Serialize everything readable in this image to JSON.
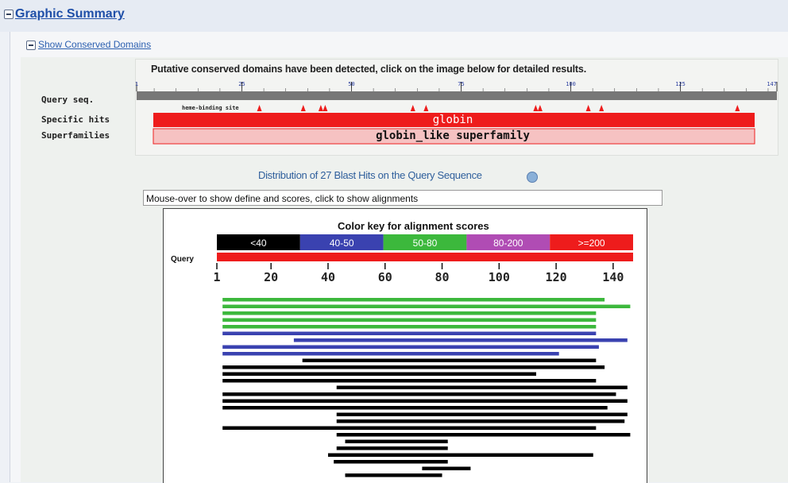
{
  "header": {
    "title": "Graphic Summary"
  },
  "conserved": {
    "toggle_label": "Show Conserved Domains",
    "message": "Putative conserved domains have been detected, click on the image below for detailed results.",
    "scale_ticks": [
      "1",
      "25",
      "50",
      "75",
      "100",
      "125",
      "147"
    ],
    "query_label": "Query seq.",
    "site_label": "heme-binding site",
    "specific_label": "Specific hits",
    "superfamilies_label": "Superfamilies",
    "specific_hit": "globin",
    "superfamily_hit": "globin_like superfamily"
  },
  "distribution": {
    "title": "Distribution of 27 Blast Hits on the Query Sequence",
    "mouse_hint": "Mouse-over to show define and scores, click to show alignments"
  },
  "color_key": {
    "title": "Color key for alignment scores",
    "bins": [
      {
        "label": "<40",
        "color": "#000000"
      },
      {
        "label": "40-50",
        "color": "#3a42b0"
      },
      {
        "label": "50-80",
        "color": "#3cb83c"
      },
      {
        "label": "80-200",
        "color": "#b04cb4"
      },
      {
        "label": ">=200",
        "color": "#ee1c1c"
      }
    ]
  },
  "query_axis": {
    "label": "Query",
    "ticks": [
      "1",
      "20",
      "40",
      "60",
      "80",
      "100",
      "120",
      "140"
    ]
  },
  "chart_data": {
    "type": "bar",
    "title": "Color key for alignment scores",
    "x_range": [
      1,
      147
    ],
    "hits": [
      {
        "start": 3,
        "end": 137,
        "score_bin": "50-80"
      },
      {
        "start": 3,
        "end": 146,
        "score_bin": "50-80"
      },
      {
        "start": 3,
        "end": 134,
        "score_bin": "50-80"
      },
      {
        "start": 3,
        "end": 134,
        "score_bin": "50-80"
      },
      {
        "start": 3,
        "end": 134,
        "score_bin": "50-80"
      },
      {
        "start": 3,
        "end": 134,
        "score_bin": "40-50"
      },
      {
        "start": 28,
        "end": 145,
        "score_bin": "40-50"
      },
      {
        "start": 3,
        "end": 135,
        "score_bin": "40-50"
      },
      {
        "start": 3,
        "end": 121,
        "score_bin": "40-50"
      },
      {
        "start": 31,
        "end": 134,
        "score_bin": "<40"
      },
      {
        "start": 3,
        "end": 137,
        "score_bin": "<40"
      },
      {
        "start": 3,
        "end": 113,
        "score_bin": "<40"
      },
      {
        "start": 3,
        "end": 134,
        "score_bin": "<40"
      },
      {
        "start": 43,
        "end": 145,
        "score_bin": "<40"
      },
      {
        "start": 3,
        "end": 141,
        "score_bin": "<40"
      },
      {
        "start": 3,
        "end": 145,
        "score_bin": "<40"
      },
      {
        "start": 3,
        "end": 138,
        "score_bin": "<40"
      },
      {
        "start": 43,
        "end": 145,
        "score_bin": "<40"
      },
      {
        "start": 43,
        "end": 144,
        "score_bin": "<40"
      },
      {
        "start": 3,
        "end": 134,
        "score_bin": "<40"
      },
      {
        "start": 43,
        "end": 146,
        "score_bin": "<40"
      },
      {
        "start": 46,
        "end": 82,
        "score_bin": "<40"
      },
      {
        "start": 43,
        "end": 82,
        "score_bin": "<40"
      },
      {
        "start": 40,
        "end": 133,
        "score_bin": "<40"
      },
      {
        "start": 42,
        "end": 82,
        "score_bin": "<40"
      },
      {
        "start": 73,
        "end": 90,
        "score_bin": "<40"
      },
      {
        "start": 46,
        "end": 80,
        "score_bin": "<40"
      }
    ]
  }
}
